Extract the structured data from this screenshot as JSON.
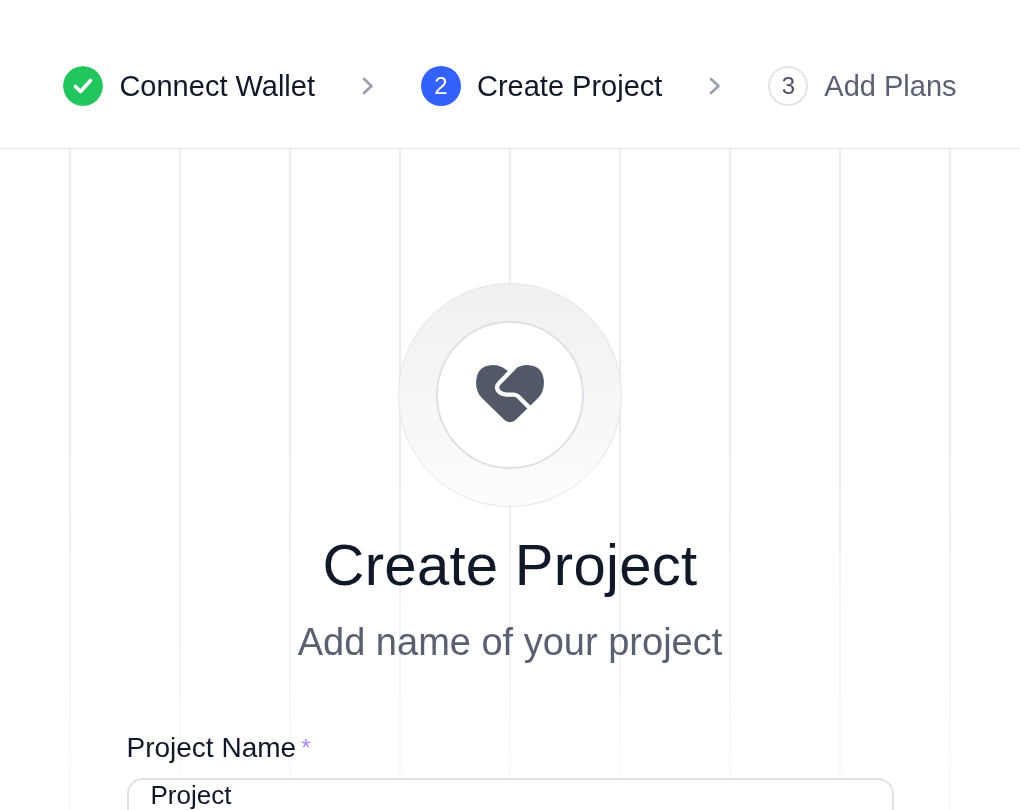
{
  "steps": [
    {
      "label": "Connect Wallet",
      "completed": true,
      "selected": false
    },
    {
      "number": "2",
      "label": "Create Project",
      "completed": false,
      "selected": true
    },
    {
      "number": "3",
      "label": "Add Plans",
      "completed": false,
      "selected": false
    }
  ],
  "hero": {
    "title": "Create Project",
    "subtitle": "Add name of your project"
  },
  "form": {
    "fields": [
      {
        "label": "Project Name",
        "required_marker": "*",
        "value": "Project"
      }
    ]
  }
}
